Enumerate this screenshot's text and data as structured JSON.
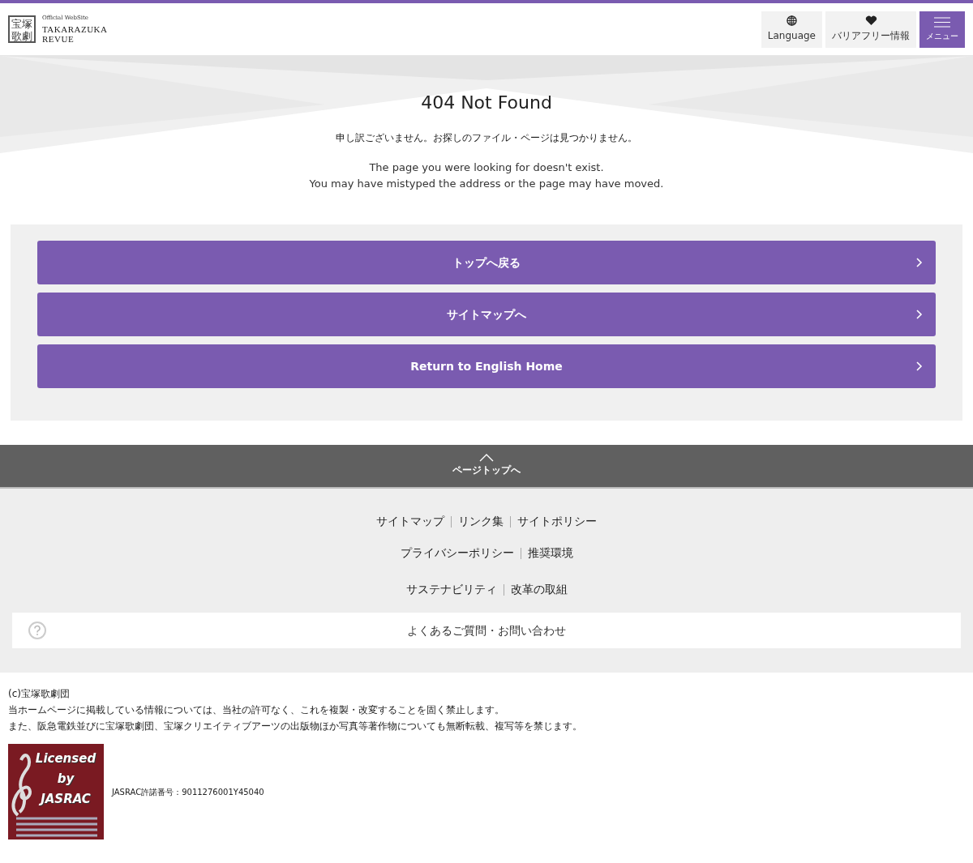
{
  "header": {
    "logo_mark": "宝塚歌劇",
    "logo_tagline": "Official WebSite",
    "logo_name_lines": [
      "TAKARAZUKA",
      "REVUE"
    ],
    "buttons": [
      {
        "kind": "language",
        "label": "Language"
      },
      {
        "kind": "barrierfree",
        "label": "バリアフリー情報"
      },
      {
        "kind": "menu",
        "label": "メニュー"
      }
    ]
  },
  "error": {
    "title": "404 Not Found",
    "message_ja": "申し訳ございません。お探しのファイル・ページは見つかりません。",
    "message_en_lines": [
      "The page you were looking for doesn't exist.",
      "You may have mistyped the address or the page may have moved."
    ]
  },
  "actions": [
    "トップへ戻る",
    "サイトマップへ",
    "Return to English Home"
  ],
  "page_top": "ページトップへ",
  "footer_links": [
    [
      "サイトマップ",
      "リンク集",
      "サイトポリシー"
    ],
    [
      "プライバシーポリシー",
      "推奨環境"
    ],
    [
      "サステナビリティ",
      "改革の取組"
    ]
  ],
  "faq": "よくあるご質問・お問い合わせ",
  "copyright_lines": [
    "(c)宝塚歌劇団",
    "当ホームページに掲載している情報については、当社の許可なく、これを複製・改変することを固く禁止します。",
    "また、阪急電鉄並びに宝塚歌劇団、宝塚クリエイティブアーツの出版物ほか写真等著作物についても無断転載、複写等を禁じます。"
  ],
  "jasrac": {
    "logo_lines": [
      "Licensed",
      "by",
      "JASRAC"
    ],
    "license": "JASRAC許諾番号：9011276001Y45040"
  }
}
